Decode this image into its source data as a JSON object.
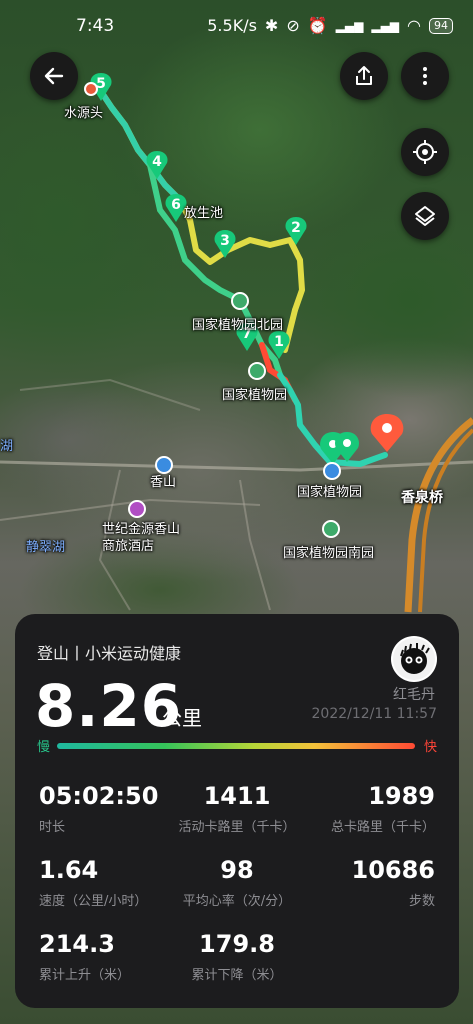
{
  "status_bar": {
    "time": "7:43",
    "network_speed": "5.5K/s",
    "battery": "94"
  },
  "map": {
    "labels": {
      "shuiyuantou": "水源头",
      "fangshengchi": "放生池",
      "botanical_north": "国家植物园北园",
      "botanical_garden": "国家植物园",
      "botanical_garden_2": "国家植物园",
      "botanical_south": "国家植物园南园",
      "xiangshan": "香山",
      "hotel": "世纪金源香山商旅酒店",
      "xiangquanqiao": "香泉桥",
      "jingcuihu": "静翠湖",
      "lake_left": "湖"
    },
    "waypoints": [
      "1",
      "2",
      "3",
      "4",
      "5",
      "6",
      "7"
    ]
  },
  "card": {
    "title": "登山丨小米运动健康",
    "username": "红毛丹",
    "timestamp": "2022/12/11 11:57",
    "distance": "8.26",
    "distance_unit": "公里",
    "slow_label": "慢",
    "fast_label": "快",
    "stats": [
      {
        "value": "05:02:50",
        "label": "时长"
      },
      {
        "value": "1411",
        "label": "活动卡路里（千卡）"
      },
      {
        "value": "1989",
        "label": "总卡路里（千卡）"
      },
      {
        "value": "1.64",
        "label": "速度（公里/小时）"
      },
      {
        "value": "98",
        "label": "平均心率（次/分）"
      },
      {
        "value": "10686",
        "label": "步数"
      },
      {
        "value": "214.3",
        "label": "累计上升（米）"
      },
      {
        "value": "179.8",
        "label": "累计下降（米）"
      }
    ]
  },
  "colors": {
    "route_teal": "#2fd3b0",
    "route_yellow": "#e8e04a",
    "route_red": "#ff4a34",
    "waypoint_green": "#17c97a",
    "end_marker": "#ff5a3c",
    "card_bg": "#1c1c1e"
  }
}
